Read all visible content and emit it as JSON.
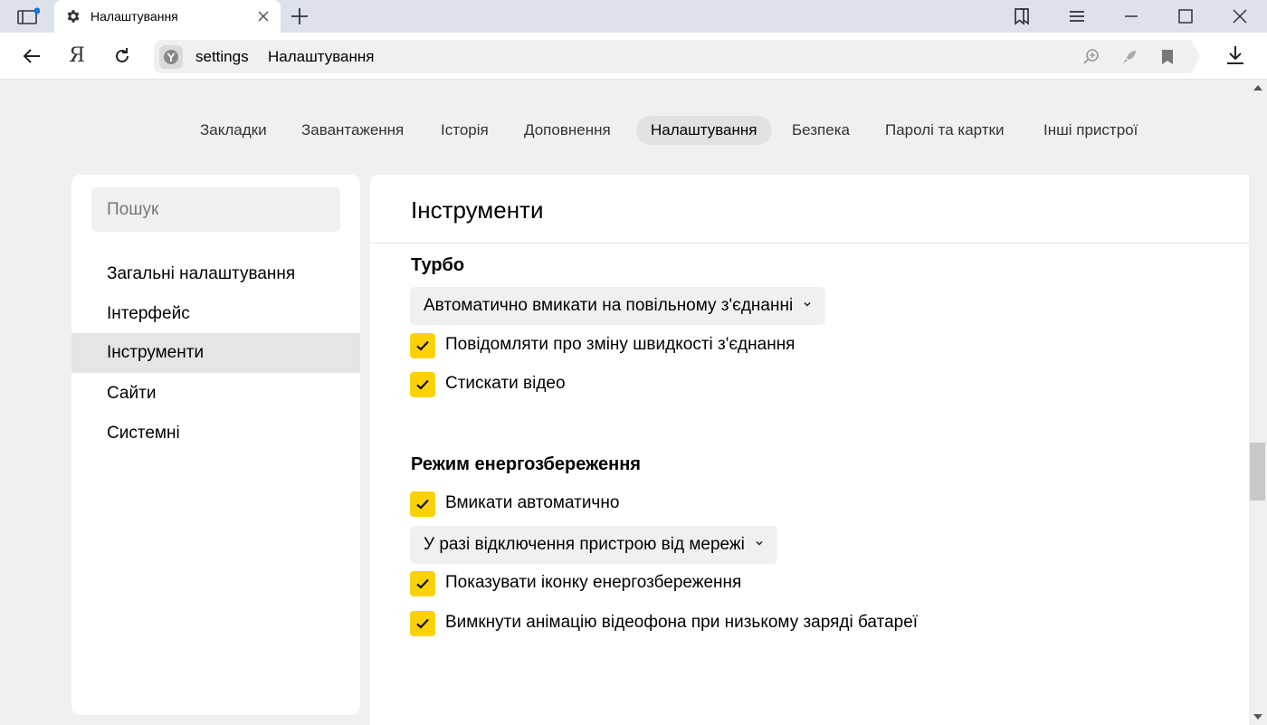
{
  "browser": {
    "tab": {
      "title": "Налаштування",
      "icon": "gear-icon"
    },
    "address": {
      "host": "settings",
      "title": "Налаштування"
    }
  },
  "settings_nav": {
    "items": [
      {
        "label": "Закладки",
        "active": false
      },
      {
        "label": "Завантаження",
        "active": false
      },
      {
        "label": "Історія",
        "active": false
      },
      {
        "label": "Доповнення",
        "active": false
      },
      {
        "label": "Налаштування",
        "active": true
      },
      {
        "label": "Безпека",
        "active": false
      },
      {
        "label": "Паролі та картки",
        "active": false
      },
      {
        "label": "Інші пристрої",
        "active": false
      }
    ]
  },
  "sidebar": {
    "search_placeholder": "Пошук",
    "items": [
      {
        "label": "Загальні налаштування",
        "active": false
      },
      {
        "label": "Інтерфейс",
        "active": false
      },
      {
        "label": "Інструменти",
        "active": true
      },
      {
        "label": "Сайти",
        "active": false
      },
      {
        "label": "Системні",
        "active": false
      }
    ]
  },
  "main": {
    "title": "Інструменти",
    "turbo": {
      "title": "Турбо",
      "mode_select": "Автоматично вмикати на повільному з'єднанні",
      "checkboxes": [
        {
          "label": "Повідомляти про зміну швидкості з'єднання",
          "checked": true
        },
        {
          "label": "Стискати відео",
          "checked": true
        }
      ]
    },
    "power_saving": {
      "title": "Режим енергозбереження",
      "auto_checkbox": {
        "label": "Вмикати автоматично",
        "checked": true
      },
      "condition_select": "У разі відключення пристрою від мережі",
      "checkboxes": [
        {
          "label": "Показувати іконку енергозбереження",
          "checked": true
        },
        {
          "label": "Вимкнути анімацію відеофона при низькому заряді батареї",
          "checked": true
        }
      ]
    }
  },
  "colors": {
    "accent": "#fcd106",
    "tabbar": "#dde1ea",
    "page_bg": "#f1f0ee"
  }
}
